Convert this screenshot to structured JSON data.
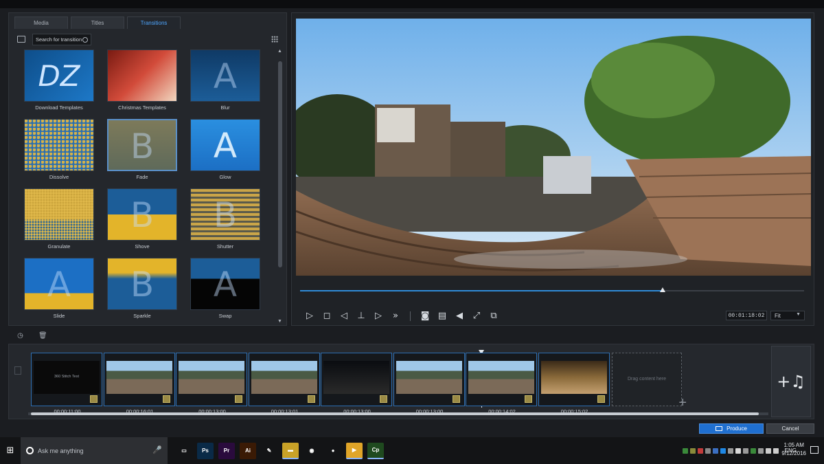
{
  "tabs": [
    {
      "label": "Media",
      "active": false
    },
    {
      "label": "Titles",
      "active": false
    },
    {
      "label": "Transitions",
      "active": true
    }
  ],
  "search": {
    "placeholder": "Search for transition"
  },
  "transitions": [
    {
      "label": "Download Templates",
      "style": "dz"
    },
    {
      "label": "Christmas Templates",
      "style": "xmas"
    },
    {
      "label": "Blur",
      "style": "blur"
    },
    {
      "label": "Dissolve",
      "style": "dissolve"
    },
    {
      "label": "Fade",
      "style": "fade",
      "selected": true
    },
    {
      "label": "Glow",
      "style": "glow"
    },
    {
      "label": "Granulate",
      "style": "granulate"
    },
    {
      "label": "Shove",
      "style": "shove"
    },
    {
      "label": "Shutter",
      "style": "shutter"
    },
    {
      "label": "Slide",
      "style": "slide"
    },
    {
      "label": "Sparkle",
      "style": "sparkle"
    },
    {
      "label": "Swap",
      "style": "swap"
    }
  ],
  "thumb_glyphs": {
    "letter_a": "A",
    "letter_b": "B",
    "dz": "DZ"
  },
  "player": {
    "progress": 0.72,
    "timecode": "00:01:18:02",
    "fit": "Fit"
  },
  "timeline": {
    "clips": [
      {
        "duration": "00:00:11:00",
        "text": "360 Stitch Test",
        "kind": "title"
      },
      {
        "duration": "00:00:16:01",
        "kind": "video"
      },
      {
        "duration": "00:00:13:00",
        "kind": "video"
      },
      {
        "duration": "00:00:13:01",
        "kind": "video"
      },
      {
        "duration": "00:00:13:00",
        "kind": "dark"
      },
      {
        "duration": "00:00:13:00",
        "kind": "video"
      },
      {
        "duration": "00:00:14:02",
        "kind": "video"
      },
      {
        "duration": "00:00:15:02",
        "kind": "warm"
      }
    ],
    "dropzone": "Drag content here"
  },
  "actions": {
    "produce": "Produce",
    "cancel": "Cancel"
  },
  "taskbar": {
    "search": "Ask me anything",
    "apps": [
      {
        "name": "task-view",
        "label": "▭",
        "color": "#131416"
      },
      {
        "name": "photoshop",
        "label": "Ps",
        "color": "#0a2a47"
      },
      {
        "name": "premiere",
        "label": "Pr",
        "color": "#2a0b3d"
      },
      {
        "name": "illustrator",
        "label": "Ai",
        "color": "#3a1a05"
      },
      {
        "name": "inkscape",
        "label": "✎",
        "color": "#131416"
      },
      {
        "name": "file-explorer",
        "label": "▬",
        "color": "#c9a227"
      },
      {
        "name": "chrome",
        "label": "◉",
        "color": "#131416"
      },
      {
        "name": "media-app",
        "label": "●",
        "color": "#131416"
      },
      {
        "name": "powerdirector",
        "label": "▶",
        "color": "#e0a528"
      },
      {
        "name": "captivate",
        "label": "Cp",
        "color": "#1f4a1f"
      }
    ],
    "lang": "ENG",
    "time": "1:05 AM",
    "date": "9/12/2016"
  }
}
